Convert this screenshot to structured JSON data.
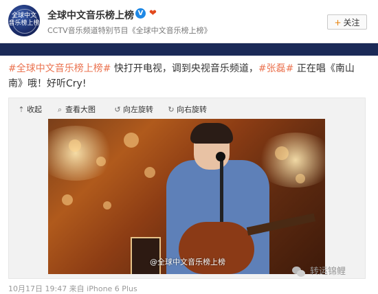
{
  "header": {
    "account_name": "全球中文音乐榜上榜",
    "verified_badge": "V",
    "description": "CCTV音乐频道特别节目《全球中文音乐榜上榜》",
    "follow_button": {
      "plus": "+",
      "label": "关注"
    },
    "avatar_text_line1": "全球中文",
    "avatar_text_line2": "音乐榜上榜"
  },
  "post": {
    "tag": "#全球中文音乐榜上榜#",
    "text_1": " 快打开电视，调到央视音乐频道，",
    "mention": "#张磊#",
    "text_2": " 正在唱《南山南》哦！好听Cry!"
  },
  "media": {
    "toolbar": [
      {
        "icon": "collapse-icon",
        "label": "收起"
      },
      {
        "icon": "zoom-icon",
        "label": "查看大图"
      },
      {
        "icon": "rotate-left-icon",
        "label": "向左旋转"
      },
      {
        "icon": "rotate-right-icon",
        "label": "向右旋转"
      }
    ],
    "photo_watermark": "@全球中文音乐榜上榜"
  },
  "overlay": {
    "wechat_watermark": "转运锦鲤"
  },
  "footer": {
    "meta": "10月17日 19:47 来自 iPhone 6 Plus"
  },
  "colors": {
    "accent_link": "#eb7350",
    "verified_blue": "#1e88e5",
    "strip_navy": "#1b2a57"
  }
}
